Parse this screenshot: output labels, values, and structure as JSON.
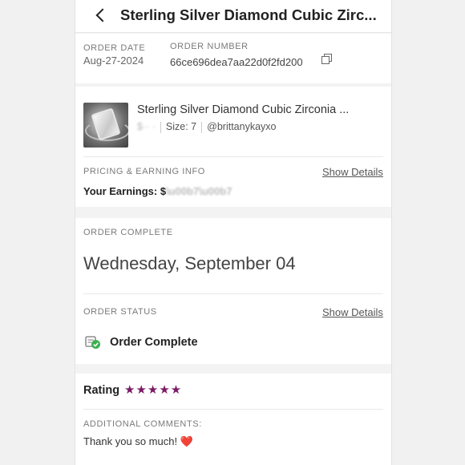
{
  "header": {
    "title": "Sterling Silver Diamond Cubic Zirc..."
  },
  "order": {
    "date_label": "ORDER DATE",
    "date_value": "Aug-27-2024",
    "number_label": "ORDER NUMBER",
    "number_value": "66ce696dea7aa22d0f2fd200"
  },
  "item": {
    "name": "Sterling Silver Diamond Cubic Zirconia ...",
    "price_obscured": "$·· ·",
    "size": "Size: 7",
    "seller": "@brittanykayxo"
  },
  "pricing": {
    "label": "PRICING & EARNING INFO",
    "show_details": "Show Details",
    "earnings": "Your Earnings: $"
  },
  "completion": {
    "label": "ORDER COMPLETE",
    "date": "Wednesday, September 04"
  },
  "status": {
    "label": "ORDER STATUS",
    "show_details": "Show Details",
    "value": "Order Complete"
  },
  "rating": {
    "label": "Rating",
    "stars": 5,
    "stars_display": "★★★★★"
  },
  "comments": {
    "label": "ADDITIONAL COMMENTS:",
    "text": "Thank you so much!",
    "emoji": "❤️"
  },
  "colors": {
    "star": "#7b1a64",
    "check": "#3cae4f",
    "heart": "#e0262f"
  }
}
